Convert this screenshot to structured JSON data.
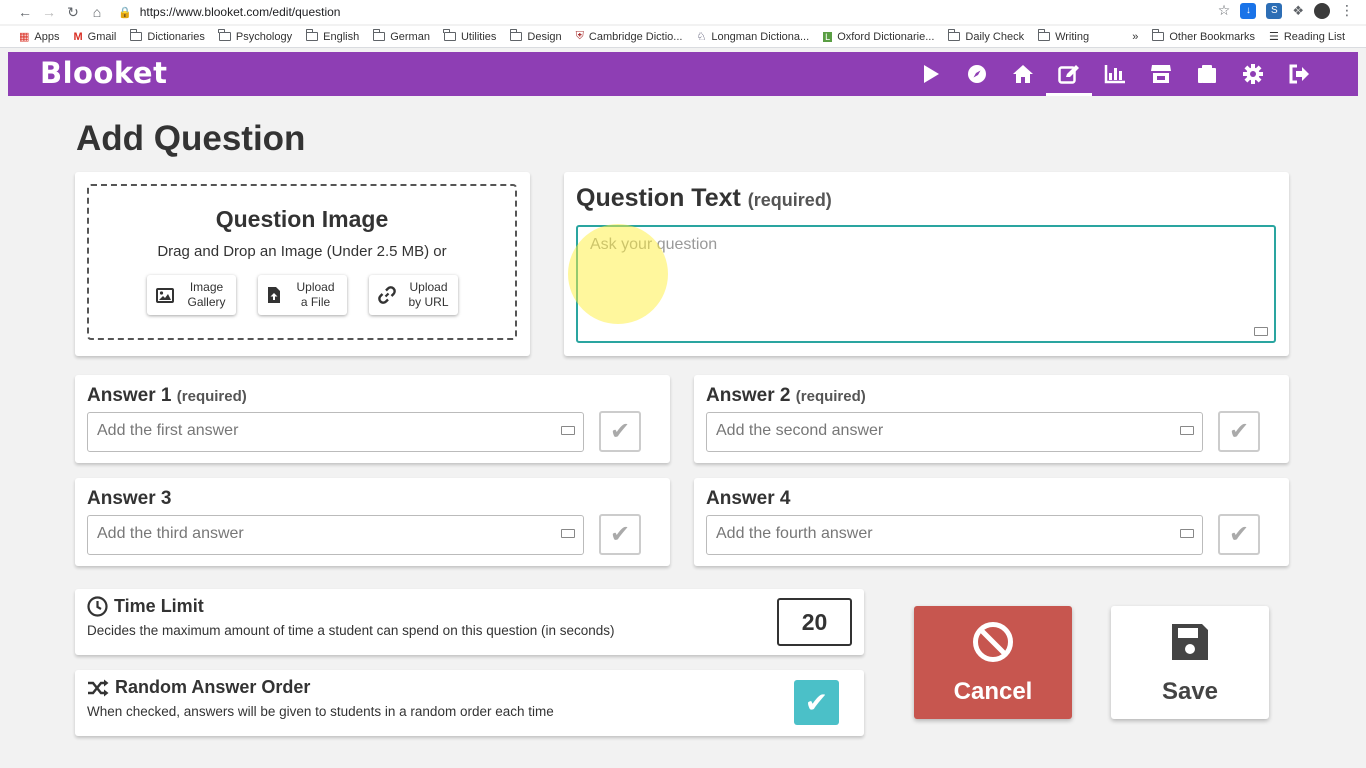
{
  "browser": {
    "url": "https://www.blooket.com/edit/question",
    "bookmarks": [
      "Apps",
      "Gmail",
      "Dictionaries",
      "Psychology",
      "English",
      "German",
      "Utilities",
      "Design",
      "Cambridge Dictio...",
      "Longman Dictiona...",
      "Oxford Dictionarie...",
      "Daily Check",
      "Writing"
    ],
    "bookmarks_more": "»",
    "other_bookmarks": "Other Bookmarks",
    "reading_list": "Reading List"
  },
  "app": {
    "logo": "Blooket",
    "nav_icons": [
      "play-icon",
      "compass-icon",
      "home-icon",
      "edit-icon",
      "stats-icon",
      "market-icon",
      "blooks-icon",
      "settings-icon",
      "logout-icon"
    ],
    "accent": "#8e3eb4"
  },
  "page": {
    "title": "Add Question",
    "image": {
      "title": "Question Image",
      "subtitle": "Drag and Drop an Image (Under 2.5 MB) or",
      "gallery_l1": "Image",
      "gallery_l2": "Gallery",
      "file_l1": "Upload",
      "file_l2": "a File",
      "url_l1": "Upload",
      "url_l2": "by URL"
    },
    "question": {
      "title": "Question Text",
      "required": "(required)",
      "placeholder": "Ask your question"
    },
    "answers": [
      {
        "title": "Answer 1",
        "required": "(required)",
        "placeholder": "Add the first answer"
      },
      {
        "title": "Answer 2",
        "required": "(required)",
        "placeholder": "Add the second answer"
      },
      {
        "title": "Answer 3",
        "required": "",
        "placeholder": "Add the third answer"
      },
      {
        "title": "Answer 4",
        "required": "",
        "placeholder": "Add the fourth answer"
      }
    ],
    "time_limit": {
      "title": "Time Limit",
      "desc": "Decides the maximum amount of time a student can spend on this question (in seconds)",
      "value": "20"
    },
    "random_order": {
      "title": "Random Answer Order",
      "desc": "When checked, answers will be given to students in a random order each time",
      "checked": true
    },
    "cancel_label": "Cancel",
    "save_label": "Save"
  }
}
